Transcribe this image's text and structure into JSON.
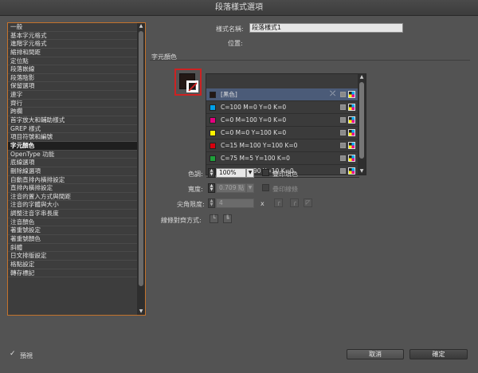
{
  "window": {
    "title": "段落樣式選項"
  },
  "categories": [
    "一般",
    "基本字元格式",
    "進階字元格式",
    "縮排和間距",
    "定位點",
    "段落嵌線",
    "段落陰影",
    "保留選項",
    "連字",
    "齊行",
    "跨欄",
    "首字放大和輔助樣式",
    "GREP 樣式",
    "項目符號和編號",
    "字元顏色",
    "OpenType 功能",
    "底線選項",
    "刪除線選項",
    "自動直排內橫排設定",
    "直排內橫排設定",
    "注音的置入方式與間距",
    "注音的字體與大小",
    "調整注音字串長度",
    "注音顏色",
    "著重號設定",
    "著重號顏色",
    "斜體",
    "日文排版設定",
    "格點設定",
    "轉存標記"
  ],
  "selected_category_index": 14,
  "form": {
    "style_name_label": "樣式名稱:",
    "style_name_value": "段落樣式1",
    "location_label": "位置:",
    "section_title": "字元顏色"
  },
  "swatches": [
    {
      "name": "[黑色]",
      "color": "#231815",
      "selected": true
    },
    {
      "name": "C=100 M=0 Y=0 K=0",
      "color": "#00a0e9",
      "selected": false
    },
    {
      "name": "C=0 M=100 Y=0 K=0",
      "color": "#e4007f",
      "selected": false
    },
    {
      "name": "C=0 M=0 Y=100 K=0",
      "color": "#fff100",
      "selected": false
    },
    {
      "name": "C=15 M=100 Y=100 K=0",
      "color": "#d7000f",
      "selected": false
    },
    {
      "name": "C=75 M=5 Y=100 K=0",
      "color": "#1fa13a",
      "selected": false
    },
    {
      "name": "C=100 M=90 Y=10 K=0",
      "color": "#172a88",
      "selected": false
    }
  ],
  "controls": {
    "tint_label": "色調:",
    "tint_value": "100%",
    "overprint_fill_label": "疊印填色",
    "weight_label": "寬度:",
    "weight_value": "0.709 點",
    "overprint_stroke_label": "疊印線條",
    "miter_label": "尖角限度:",
    "miter_value": "4",
    "miter_unit": "x",
    "stroke_align_label": "線條對齊方式:"
  },
  "footer": {
    "preview_label": "預視",
    "preview_checked": true,
    "cancel_label": "取消",
    "ok_label": "確定"
  },
  "colors": {
    "accent": "#c4732c",
    "selected_row": "#4b5b78"
  }
}
